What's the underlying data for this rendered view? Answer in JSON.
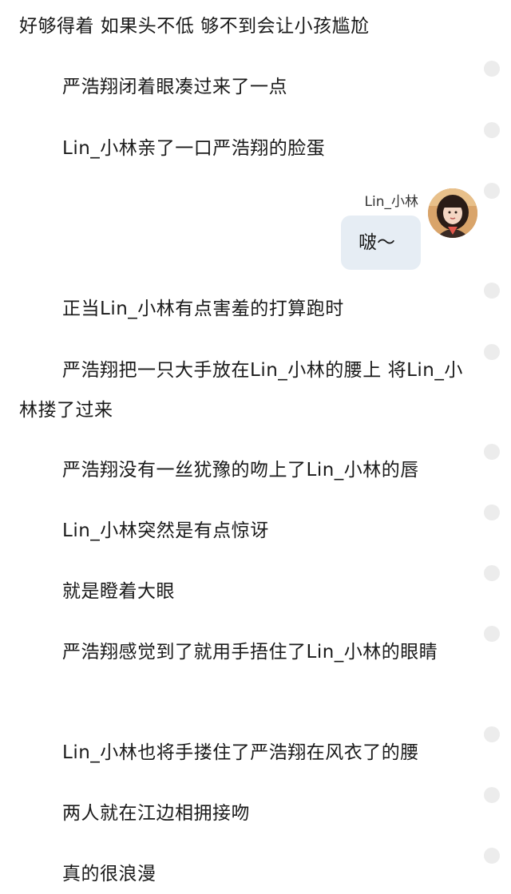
{
  "paragraphs": [
    "好够得着 如果头不低 够不到会让小孩尴尬",
    "严浩翔闭着眼凑过来了一点",
    "Lin_小林亲了一口严浩翔的脸蛋",
    "正当Lin_小林有点害羞的打算跑时",
    "严浩翔把一只大手放在Lin_小林的腰上 将Lin_小林搂了过来",
    "严浩翔没有一丝犹豫的吻上了Lin_小林的唇",
    "Lin_小林突然是有点惊讶",
    "就是瞪着大眼",
    "严浩翔感觉到了就用手捂住了Lin_小林的眼睛",
    "Lin_小林也将手搂住了严浩翔在风衣了的腰",
    "两人就在江边相拥接吻",
    "真的很浪漫"
  ],
  "chat": {
    "name": "Lin_小林",
    "message": "啵～",
    "avatar_icon": "avatar-photo",
    "bubble_color": "#e6edf4"
  },
  "colors": {
    "text": "#1a1a1a",
    "marker": "#ececec"
  }
}
